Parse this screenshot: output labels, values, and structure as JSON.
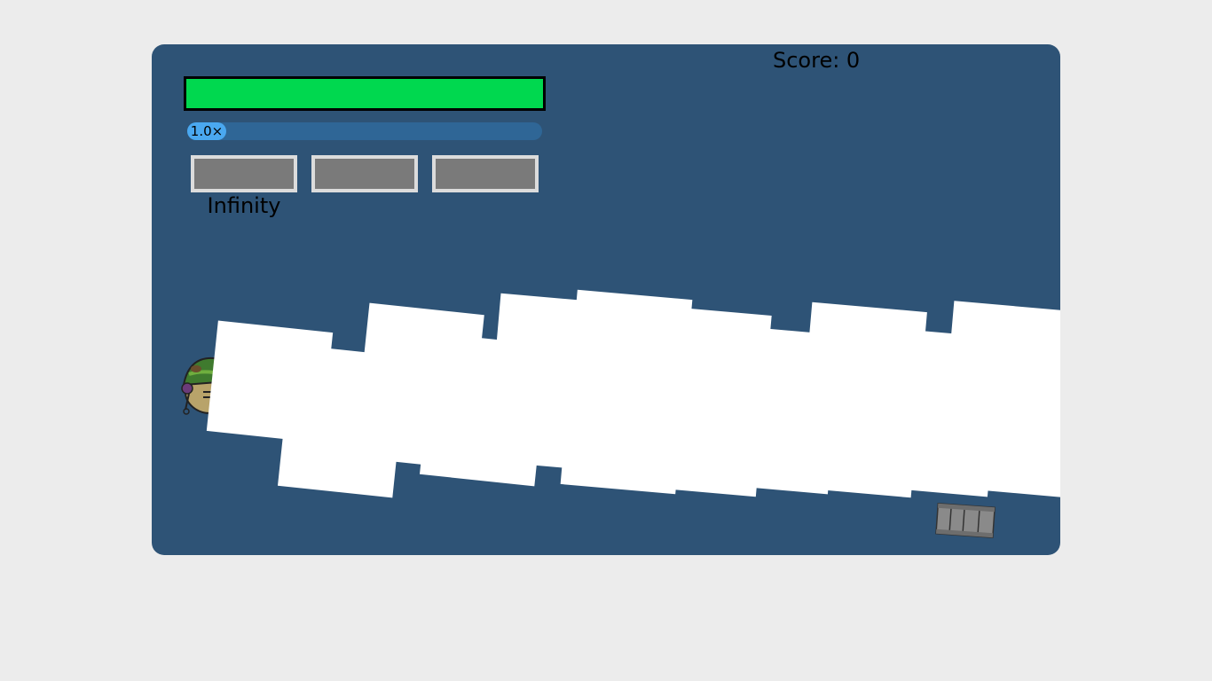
{
  "hud": {
    "score_label": "Score: 0",
    "health_percent": 100,
    "health_color": "#00d84f",
    "speed_label": "1.0×",
    "speed_fraction": 0.0,
    "weapon_slots": [
      "",
      "",
      ""
    ],
    "ammo_label": "Infinity"
  },
  "scene": {
    "background_color": "#2e5376",
    "player_icon": "soldier-helmet-icon",
    "pickup_icon": "ammo-crate-icon"
  }
}
